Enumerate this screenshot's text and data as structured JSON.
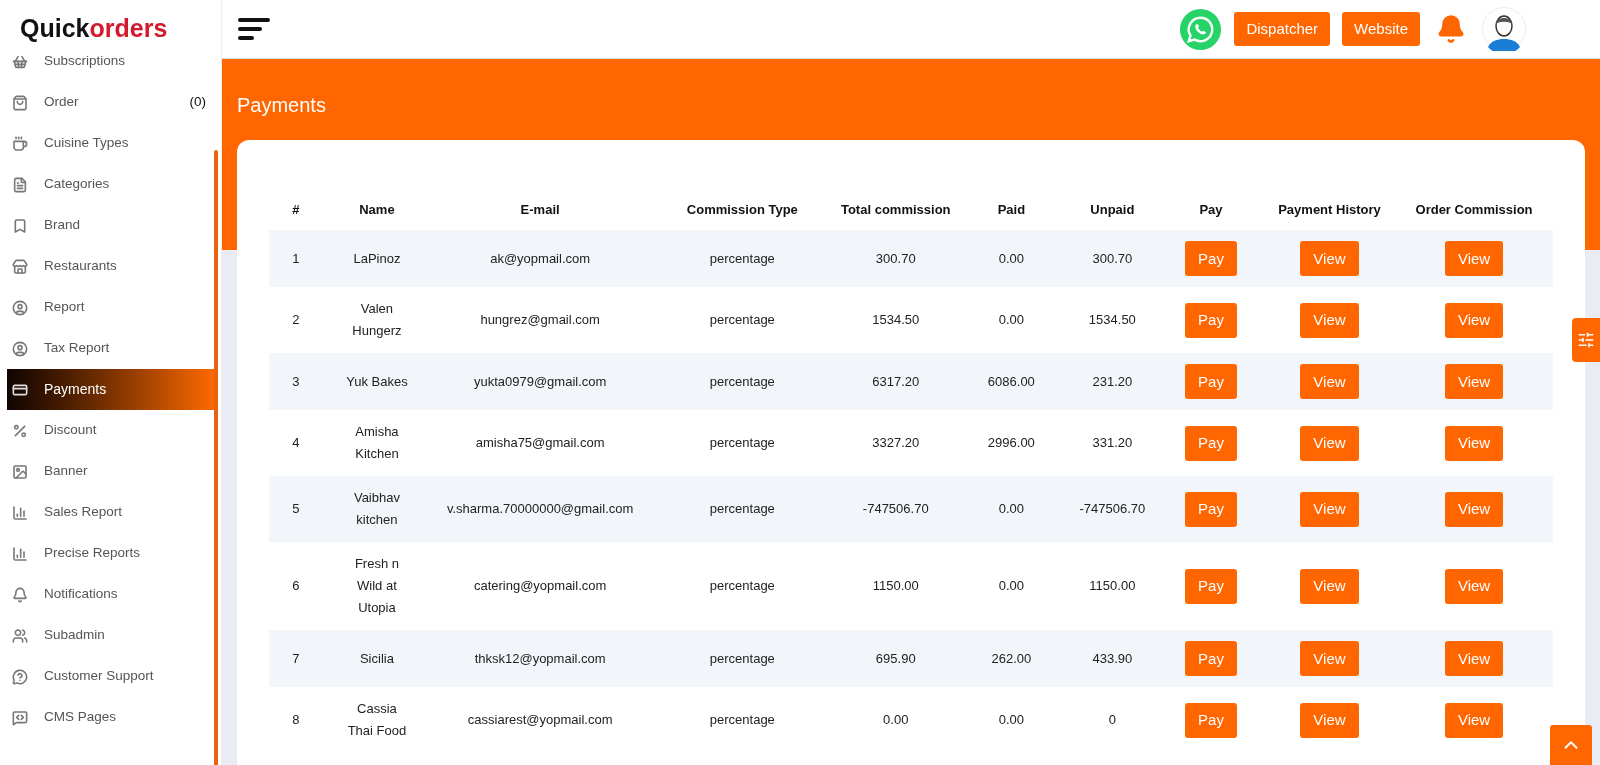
{
  "logo": {
    "part1": "Quick",
    "part2": "orders"
  },
  "sidebar": {
    "items": [
      {
        "label": "Subscriptions",
        "selected": false
      },
      {
        "label": "Order",
        "count": "(0)",
        "selected": false
      },
      {
        "label": "Cuisine Types",
        "selected": false
      },
      {
        "label": "Categories",
        "selected": false
      },
      {
        "label": "Brand",
        "selected": false
      },
      {
        "label": "Restaurants",
        "selected": false
      },
      {
        "label": "Report",
        "selected": false
      },
      {
        "label": "Tax Report",
        "selected": false
      },
      {
        "label": "Payments",
        "selected": true
      },
      {
        "label": "Discount",
        "selected": false
      },
      {
        "label": "Banner",
        "selected": false
      },
      {
        "label": "Sales Report",
        "selected": false
      },
      {
        "label": "Precise Reports",
        "selected": false
      },
      {
        "label": "Notifications",
        "selected": false
      },
      {
        "label": "Subadmin",
        "selected": false
      },
      {
        "label": "Customer Support",
        "selected": false
      },
      {
        "label": "CMS Pages",
        "selected": false
      }
    ]
  },
  "header": {
    "buttons": [
      "Dispatcher",
      "Website"
    ]
  },
  "page_title": "Payments",
  "table": {
    "columns": [
      "#",
      "Name",
      "E-mail",
      "Commission Type",
      "Total commission",
      "Paid",
      "Unpaid",
      "Pay",
      "Payment History",
      "Order Commission"
    ],
    "rows": [
      {
        "num": "1",
        "name": "LaPinoz",
        "email": "ak@yopmail.com",
        "type": "percentage",
        "total": "300.70",
        "paid": "0.00",
        "unpaid": "300.70",
        "pay": "Pay",
        "history": "View",
        "order": "View"
      },
      {
        "num": "2",
        "name": "Valen Hungerz",
        "email": "hungrez@gmail.com",
        "type": "percentage",
        "total": "1534.50",
        "paid": "0.00",
        "unpaid": "1534.50",
        "pay": "Pay",
        "history": "View",
        "order": "View"
      },
      {
        "num": "3",
        "name": "Yuk Bakes",
        "email": "yukta0979@gmail.com",
        "type": "percentage",
        "total": "6317.20",
        "paid": "6086.00",
        "unpaid": "231.20",
        "pay": "Pay",
        "history": "View",
        "order": "View"
      },
      {
        "num": "4",
        "name": "Amisha Kitchen",
        "email": "amisha75@gmail.com",
        "type": "percentage",
        "total": "3327.20",
        "paid": "2996.00",
        "unpaid": "331.20",
        "pay": "Pay",
        "history": "View",
        "order": "View"
      },
      {
        "num": "5",
        "name": "Vaibhav kitchen",
        "email": "v.sharma.70000000@gmail.com",
        "type": "percentage",
        "total": "-747506.70",
        "paid": "0.00",
        "unpaid": "-747506.70",
        "pay": "Pay",
        "history": "View",
        "order": "View"
      },
      {
        "num": "6",
        "name": "Fresh n Wild at Utopia",
        "email": "catering@yopmail.com",
        "type": "percentage",
        "total": "1150.00",
        "paid": "0.00",
        "unpaid": "1150.00",
        "pay": "Pay",
        "history": "View",
        "order": "View"
      },
      {
        "num": "7",
        "name": "Sicilia",
        "email": "thksk12@yopmail.com",
        "type": "percentage",
        "total": "695.90",
        "paid": "262.00",
        "unpaid": "433.90",
        "pay": "Pay",
        "history": "View",
        "order": "View"
      },
      {
        "num": "8",
        "name": "Cassia Thai Food",
        "email": "cassiarest@yopmail.com",
        "type": "percentage",
        "total": "0.00",
        "paid": "0.00",
        "unpaid": "0",
        "pay": "Pay",
        "history": "View",
        "order": "View"
      }
    ]
  }
}
